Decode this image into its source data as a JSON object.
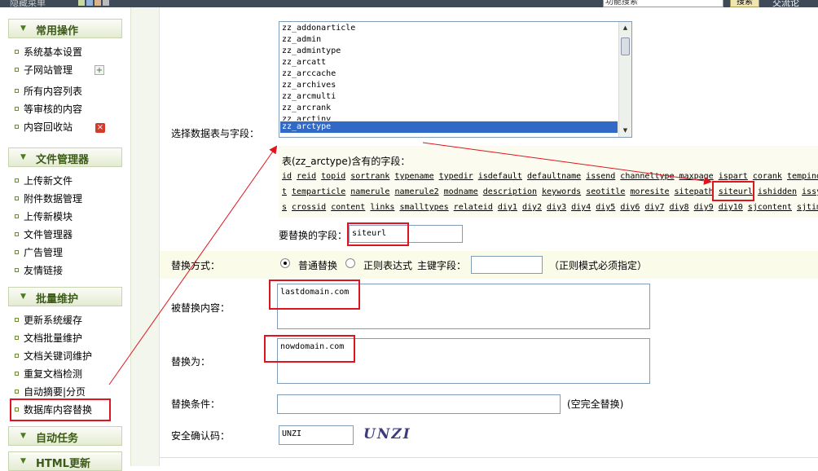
{
  "topbar": {
    "hint": "隐藏菜单",
    "search_value": "功能搜索",
    "search_button": "搜索",
    "exchange_label": "交流论"
  },
  "sidebar": {
    "sections": [
      {
        "title": "常用操作",
        "items": [
          "系统基本设置",
          "子网站管理",
          "所有内容列表",
          "等审核的内容",
          "内容回收站"
        ]
      },
      {
        "title": "文件管理器",
        "items": [
          "上传新文件",
          "附件数据管理",
          "上传新模块",
          "文件管理器",
          "广告管理",
          "友情链接"
        ]
      },
      {
        "title": "批量维护",
        "items": [
          "更新系统缓存",
          "文档批量维护",
          "文档关键词维护",
          "重复文档检测",
          "自动摘要|分页",
          "数据库内容替换"
        ]
      },
      {
        "title": "自动任务",
        "items": []
      },
      {
        "title": "HTML更新",
        "items": []
      }
    ],
    "icons": {
      "subsite": "add-page-icon",
      "recycle": "shield-icon"
    }
  },
  "form": {
    "select_label": "选择数据表与字段：",
    "tables": [
      "zz_addonarticle",
      "zz_admin",
      "zz_admintype",
      "zz_arcatt",
      "zz_arccache",
      "zz_archives",
      "zz_arcmulti",
      "zz_arcrank",
      "zz_arctiny",
      "zz_arctype"
    ],
    "selected_table": "zz_arctype",
    "fields_title": "表(zz_arctype)含有的字段：",
    "field_rows": [
      [
        "id",
        "reid",
        "topid",
        "sortrank",
        "typename",
        "typedir",
        "isdefault",
        "defaultname",
        "issend",
        "channeltype",
        "maxpage",
        "ispart",
        "corank",
        "tempindex"
      ],
      [
        "t",
        "temparticle",
        "namerule",
        "namerule2",
        "modname",
        "description",
        "keywords",
        "seotitle",
        "moresite",
        "sitepath",
        "siteurl",
        "ishidden",
        "issy"
      ],
      [
        "s",
        "crossid",
        "content",
        "links",
        "smalltypes",
        "relateid",
        "diy1",
        "diy2",
        "diy3",
        "diy4",
        "diy5",
        "diy6",
        "diy7",
        "diy8",
        "diy9",
        "diy10",
        "sjcontent",
        "sjtime"
      ]
    ],
    "replace_field_label": "要替换的字段：",
    "replace_field_value": "siteurl",
    "mode_label": "替换方式：",
    "mode_normal": "普通替换",
    "mode_regex": "正则表达式",
    "primary_key_label": "主键字段：",
    "primary_key_value": "",
    "regex_hint": "（正则模式必须指定）",
    "replaced_label": "被替换内容：",
    "replaced_value": "lastdomain.com",
    "replace_with_label": "替换为：",
    "replace_with_value": "nowdomain.com",
    "condition_label": "替换条件：",
    "condition_value": "",
    "condition_hint": "(空完全替换)",
    "captcha_label": "安全确认码：",
    "captcha_value": "UNZI",
    "captcha_image_text": "UNZI"
  },
  "colors": {
    "annotation_red": "#e0141e",
    "selection_blue": "#3169c6",
    "sidebar_green": "#3a5a16"
  }
}
